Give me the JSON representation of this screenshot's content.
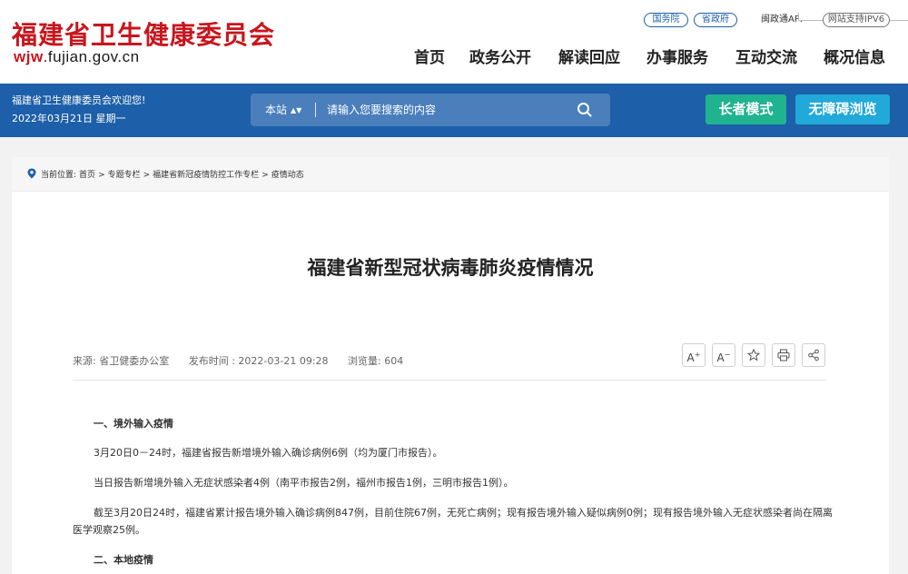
{
  "header": {
    "site_name": "福建省卫生健康委员会",
    "site_url_bold": "wjw",
    "site_url_rest": ".fujian.gov.cn",
    "top_links": [
      "国务院",
      "省政府"
    ],
    "app_link": "闽政通APP",
    "ipv6": "网站支持IPV6",
    "nav": [
      "首页",
      "政务公开",
      "解读回应",
      "办事服务",
      "互动交流",
      "概况信息"
    ]
  },
  "bar": {
    "welcome": "福建省卫生健康委员会欢迎您!",
    "date": "2022年03月21日 星期一",
    "search_scope": "本站",
    "search_placeholder": "请输入您要搜索的内容",
    "elder_mode": "长者模式",
    "accessibility": "无障碍浏览"
  },
  "breadcrumb": {
    "label": "当前位置:",
    "items": [
      "首页",
      ">",
      "专题专栏",
      ">",
      "福建省新冠疫情防控工作专栏",
      ">",
      "疫情动态"
    ]
  },
  "article": {
    "title": "福建省新型冠状病毒肺炎疫情情况",
    "source": "来源: 省卫健委办公室",
    "published": "发布时间 : 2022-03-21 09:28",
    "views": "浏览量: 604",
    "tools": [
      "A+",
      "A-",
      "star-icon",
      "print-icon",
      "share-icon"
    ],
    "paragraphs": [
      "一、境外输入疫情",
      "3月20日0－24时，福建省报告新增境外输入确诊病例6例（均为厦门市报告）。",
      "当日报告新增境外输入无症状感染者4例（南平市报告2例，福州市报告1例，三明市报告1例）。",
      "截至3月20日24时，福建省累计报告境外输入确诊病例847例，目前住院67例，无死亡病例；现有报告境外输入疑似病例0例；现有报告境外输入无症状感染者尚在隔离医学观察25例。",
      "二、本地疫情"
    ]
  },
  "colors": {
    "brand_red": "#c8161d",
    "brand_blue": "#1d5fa8",
    "elder_green": "#1fb48f",
    "access_cyan": "#21a9d9"
  }
}
